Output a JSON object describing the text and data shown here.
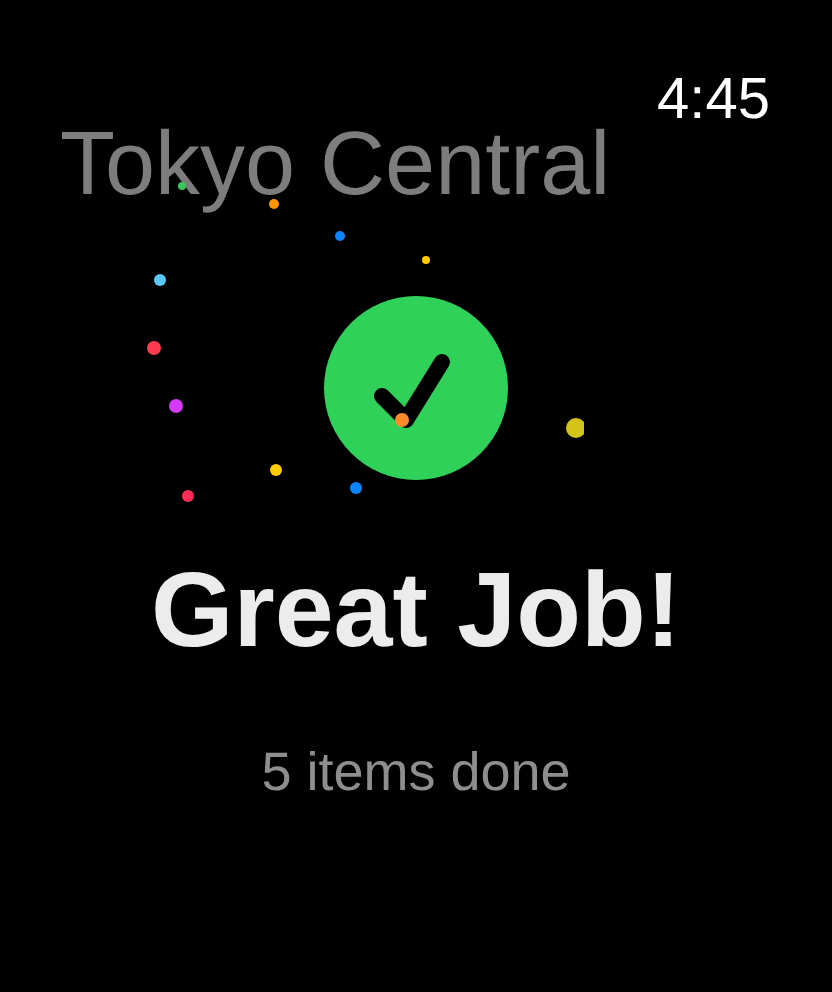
{
  "status_bar": {
    "time": "4:45"
  },
  "title": "Tokyo Central",
  "result": {
    "heading": "Great Job!",
    "subtitle": "5 items done"
  }
}
